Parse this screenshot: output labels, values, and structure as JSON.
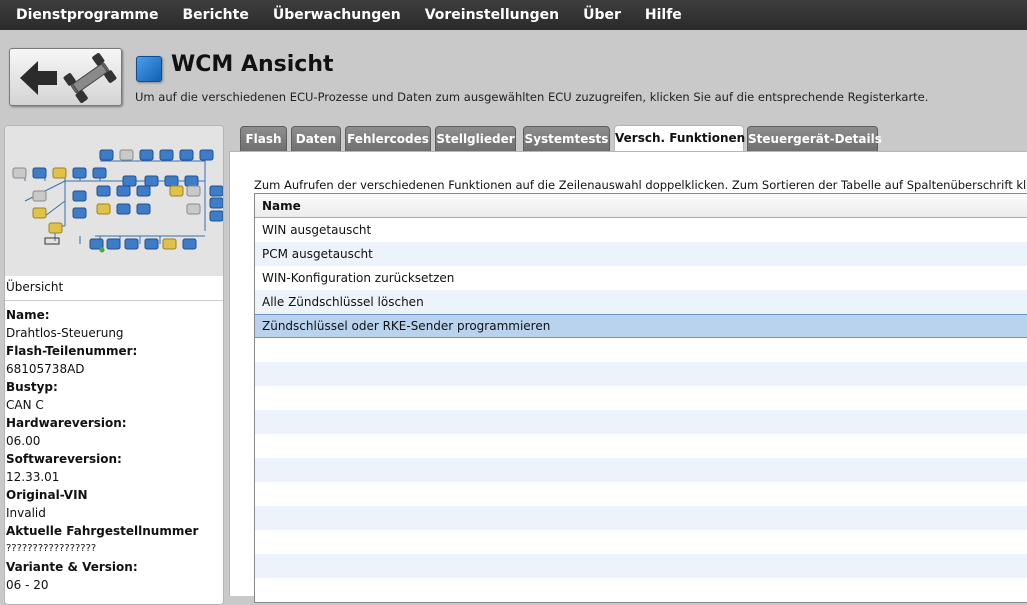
{
  "menu": [
    "Dienstprogramme",
    "Berichte",
    "Überwachungen",
    "Voreinstellungen",
    "Über",
    "Hilfe"
  ],
  "header": {
    "title": "WCM Ansicht",
    "subtitle": "Um auf die verschiedenen ECU-Prozesse und Daten zum ausgewählten ECU zuzugreifen, klicken Sie auf die entsprechende Registerkarte."
  },
  "left_panel": {
    "overview_label": "Übersicht",
    "fields": [
      {
        "label": "Name:",
        "value": "Drahtlos-Steuerung"
      },
      {
        "label": "Flash-Teilenummer:",
        "value": "68105738AD"
      },
      {
        "label": "Bustyp:",
        "value": "CAN C"
      },
      {
        "label": "Hardwareversion:",
        "value": "06.00"
      },
      {
        "label": "Softwareversion:",
        "value": "12.33.01"
      },
      {
        "label": "Original-VIN",
        "value": "Invalid"
      },
      {
        "label": "Aktuelle Fahrgestellnummer",
        "value": "?????????????????"
      },
      {
        "label": "Variante & Version:",
        "value": "06 - 20"
      }
    ]
  },
  "tabs": [
    {
      "label": "Flash"
    },
    {
      "label": "Daten"
    },
    {
      "label": "Fehlercodes"
    },
    {
      "label": "Stellglieder"
    },
    {
      "label": "Systemtests"
    },
    {
      "label": "Versch. Funktionen",
      "active": true
    },
    {
      "label": "Steuergerät-Details"
    }
  ],
  "content": {
    "instructions": "Zum Aufrufen der verschiedenen Funktionen auf die Zeilenauswahl doppelklicken.  Zum Sortieren der Tabelle auf Spaltenüberschrift klicken.",
    "table": {
      "header": "Name",
      "rows": [
        "WIN ausgetauscht",
        "PCM ausgetauscht",
        "WIN-Konfiguration zurücksetzen",
        "Alle Zündschlüssel löschen",
        "Zündschlüssel oder RKE-Sender programmieren"
      ],
      "selected_index": 4
    }
  },
  "colors": {
    "menubar": "#2f2f2f",
    "tab_inactive": "#7d7d7d",
    "row_selected": "#b9d3ef",
    "row_alt": "#edf3fb",
    "title_icon": "#1f77d0"
  },
  "icons": {
    "back_button": "back-arrow-chassis-icon",
    "title": "blue-square-icon"
  }
}
